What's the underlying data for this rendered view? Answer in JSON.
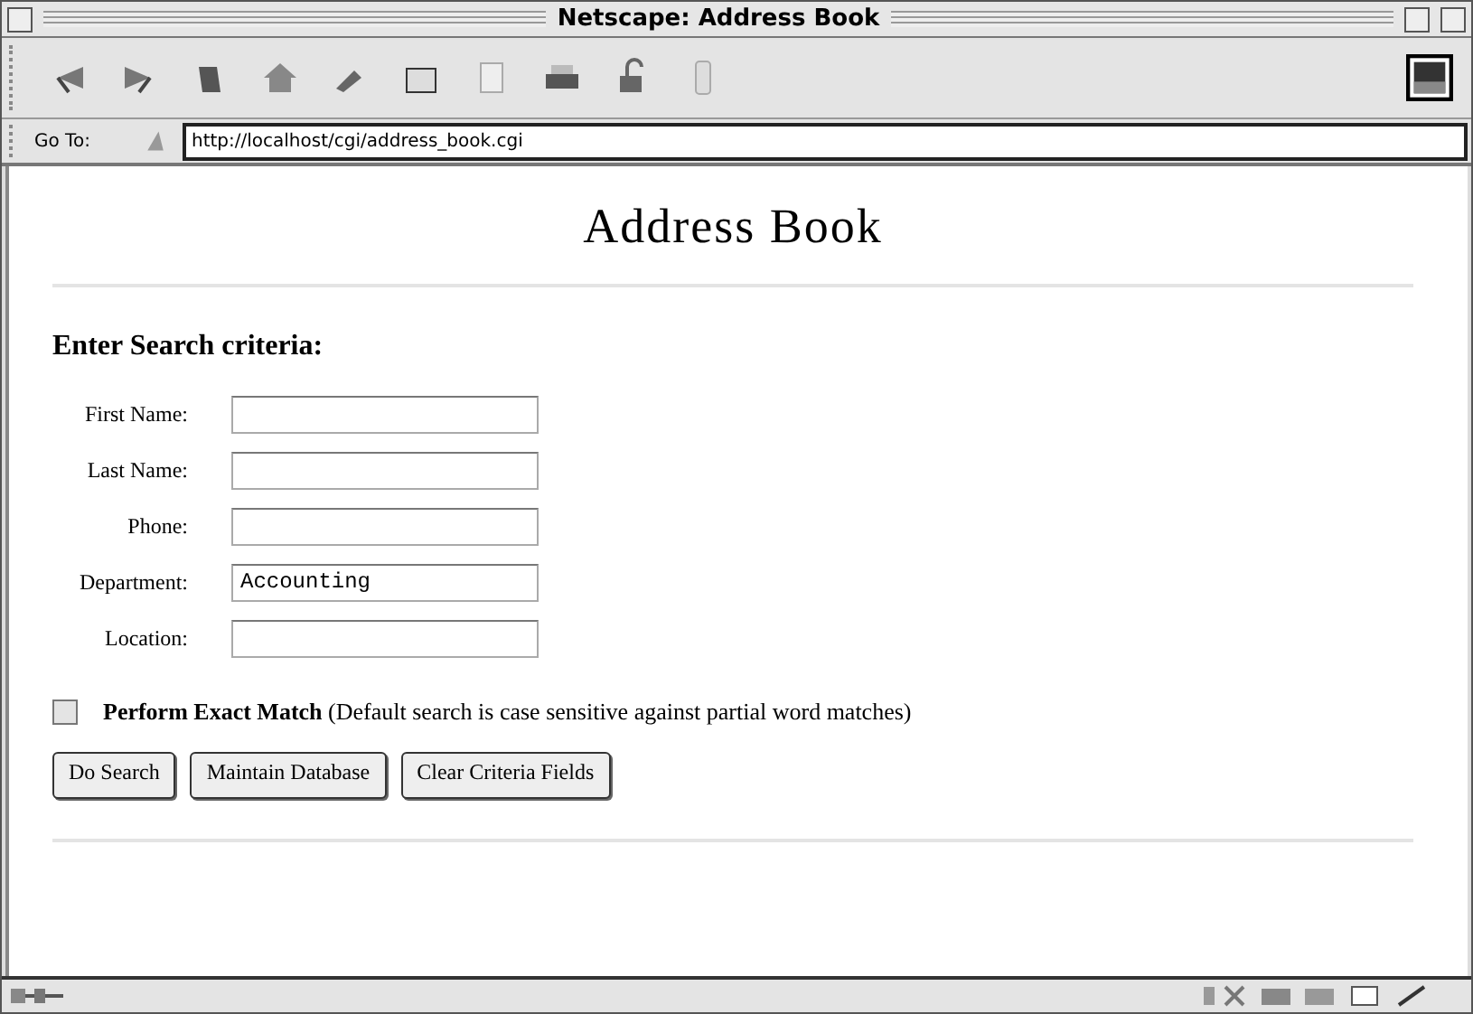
{
  "window": {
    "title": "Netscape: Address Book"
  },
  "location_bar": {
    "label": "Go To:",
    "url": "http://localhost/cgi/address_book.cgi"
  },
  "page": {
    "heading": "Address Book",
    "section_title": "Enter Search criteria:",
    "fields": [
      {
        "label": "First Name:"
      },
      {
        "label": "Last Name:"
      },
      {
        "label": "Phone:"
      },
      {
        "label": "Department:",
        "value": "Accounting"
      },
      {
        "label": "Location:"
      }
    ],
    "exact_match": {
      "label": "Perform Exact Match",
      "note": "(Default search is case sensitive against partial word matches)",
      "checked": false
    },
    "buttons": [
      "Do Search",
      "Maintain Database",
      "Clear Criteria Fields"
    ]
  }
}
